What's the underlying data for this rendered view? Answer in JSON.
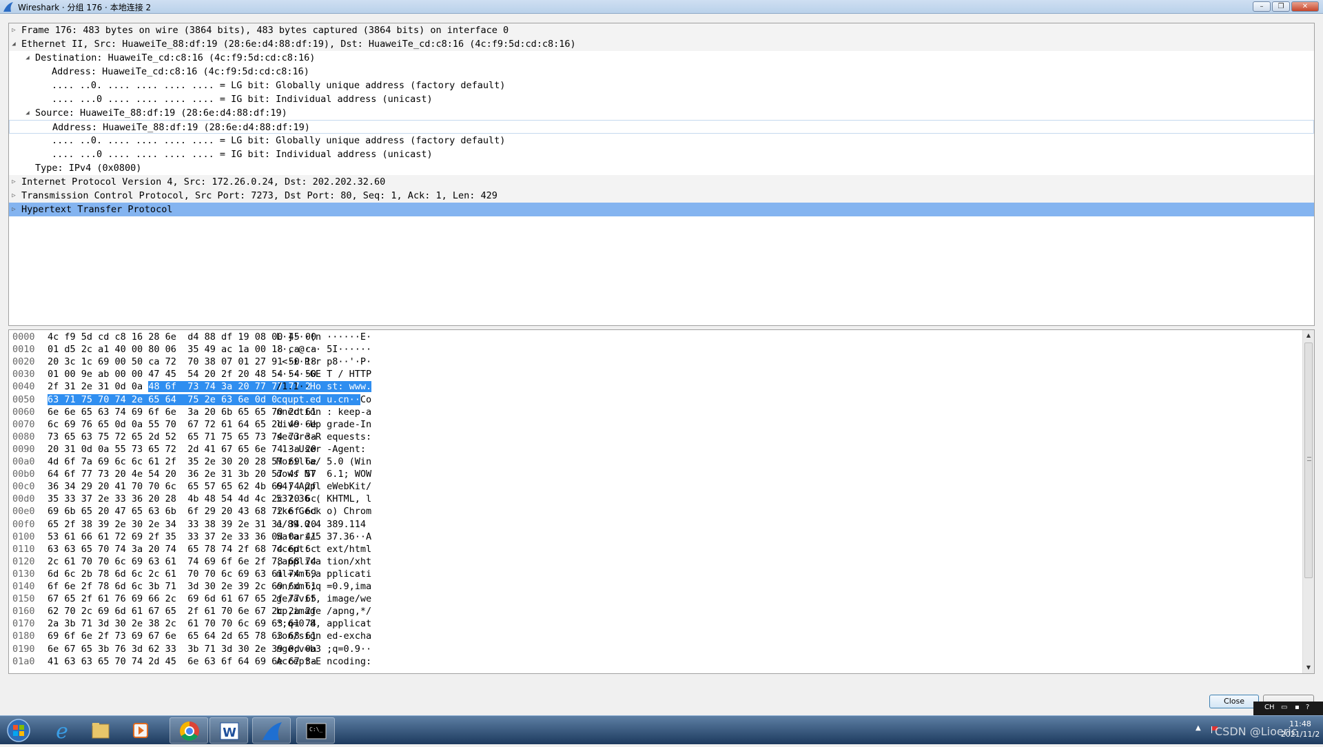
{
  "window": {
    "title": "Wireshark · 分组 176 · 本地连接 2",
    "controls": {
      "minimize": "–",
      "maximize": "❐",
      "close": "✕"
    }
  },
  "detail_tree": [
    {
      "expander": "collapsed",
      "text": "Frame 176: 483 bytes on wire (3864 bits), 483 bytes captured (3864 bits) on interface 0",
      "shaded": true
    },
    {
      "expander": "expanded",
      "text": "Ethernet II, Src: HuaweiTe_88:df:19 (28:6e:d4:88:df:19), Dst: HuaweiTe_cd:c8:16 (4c:f9:5d:cd:c8:16)",
      "shaded": true
    },
    {
      "expander": "expanded",
      "text": "Destination: HuaweiTe_cd:c8:16 (4c:f9:5d:cd:c8:16)"
    },
    {
      "expander": "none",
      "text": "Address: HuaweiTe_cd:c8:16 (4c:f9:5d:cd:c8:16)"
    },
    {
      "expander": "none",
      "text": ".... ..0. .... .... .... .... = LG bit: Globally unique address (factory default)"
    },
    {
      "expander": "none",
      "text": ".... ...0 .... .... .... .... = IG bit: Individual address (unicast)"
    },
    {
      "expander": "expanded",
      "text": "Source: HuaweiTe_88:df:19 (28:6e:d4:88:df:19)"
    },
    {
      "expander": "none",
      "text": "Address: HuaweiTe_88:df:19 (28:6e:d4:88:df:19)",
      "focused": true
    },
    {
      "expander": "none",
      "text": ".... ..0. .... .... .... .... = LG bit: Globally unique address (factory default)"
    },
    {
      "expander": "none",
      "text": ".... ...0 .... .... .... .... = IG bit: Individual address (unicast)"
    },
    {
      "expander": "none",
      "text": "Type: IPv4 (0x0800)"
    },
    {
      "expander": "collapsed",
      "text": "Internet Protocol Version 4, Src: 172.26.0.24, Dst: 202.202.32.60",
      "shaded": true
    },
    {
      "expander": "collapsed",
      "text": "Transmission Control Protocol, Src Port: 7273, Dst Port: 80, Seq: 1, Ack: 1, Len: 429",
      "shaded": true
    },
    {
      "expander": "collapsed",
      "text": "Hypertext Transfer Protocol",
      "selected": true
    }
  ],
  "hex_rows": [
    {
      "offset": "0000",
      "hex": "4c f9 5d cd c8 16 28 6e  d4 88 df 19 08 00 45 00",
      "ascii": "L·]···(n ······E·"
    },
    {
      "offset": "0010",
      "hex": "01 d5 2c a1 40 00 80 06  35 49 ac 1a 00 18 ca ca",
      "ascii": "··,·@··· 5I······"
    },
    {
      "offset": "0020",
      "hex": "20 3c 1c 69 00 50 ca 72  70 38 07 01 27 91 50 18",
      "ascii": " <·i·P·r p8··'·P·"
    },
    {
      "offset": "0030",
      "hex": "01 00 9e ab 00 00 47 45  54 20 2f 20 48 54 54 50",
      "ascii": "······GE T / HTTP"
    },
    {
      "offset": "0040",
      "hex": "2f 31 2e 31 0d 0a 48 6f  73 74 3a 20 77 77 77 2e",
      "ascii": "/1.1··Ho st: www.",
      "hl_from": 6
    },
    {
      "offset": "0050",
      "hex": "63 71 75 70 74 2e 65 64  75 2e 63 6e 0d 0a 43 6f",
      "ascii": "cqupt.ed u.cn··Co",
      "hl_to": 14
    },
    {
      "offset": "0060",
      "hex": "6e 6e 65 63 74 69 6f 6e  3a 20 6b 65 65 70 2d 61",
      "ascii": "nnection : keep-a"
    },
    {
      "offset": "0070",
      "hex": "6c 69 76 65 0d 0a 55 70  67 72 61 64 65 2d 49 6e",
      "ascii": "live··Up grade-In"
    },
    {
      "offset": "0080",
      "hex": "73 65 63 75 72 65 2d 52  65 71 75 65 73 74 73 3a",
      "ascii": "secure-R equests:"
    },
    {
      "offset": "0090",
      "hex": "20 31 0d 0a 55 73 65 72  2d 41 67 65 6e 74 3a 20",
      "ascii": " 1··User -Agent: "
    },
    {
      "offset": "00a0",
      "hex": "4d 6f 7a 69 6c 6c 61 2f  35 2e 30 20 28 57 69 6e",
      "ascii": "Mozilla/ 5.0 (Win"
    },
    {
      "offset": "00b0",
      "hex": "64 6f 77 73 20 4e 54 20  36 2e 31 3b 20 57 4f 57",
      "ascii": "dows NT  6.1; WOW"
    },
    {
      "offset": "00c0",
      "hex": "36 34 29 20 41 70 70 6c  65 57 65 62 4b 69 74 2f",
      "ascii": "64) Appl eWebKit/"
    },
    {
      "offset": "00d0",
      "hex": "35 33 37 2e 33 36 20 28  4b 48 54 4d 4c 2c 20 6c",
      "ascii": "537.36 ( KHTML, l"
    },
    {
      "offset": "00e0",
      "hex": "69 6b 65 20 47 65 63 6b  6f 29 20 43 68 72 6f 6d",
      "ascii": "ike Geck o) Chrom"
    },
    {
      "offset": "00f0",
      "hex": "65 2f 38 39 2e 30 2e 34  33 38 39 2e 31 31 34 20",
      "ascii": "e/89.0.4 389.114 "
    },
    {
      "offset": "0100",
      "hex": "53 61 66 61 72 69 2f 35  33 37 2e 33 36 0d 0a 41",
      "ascii": "Safari/5 37.36··A"
    },
    {
      "offset": "0110",
      "hex": "63 63 65 70 74 3a 20 74  65 78 74 2f 68 74 6d 6c",
      "ascii": "ccept: t ext/html"
    },
    {
      "offset": "0120",
      "hex": "2c 61 70 70 6c 69 63 61  74 69 6f 6e 2f 78 68 74",
      "ascii": ",applica tion/xht"
    },
    {
      "offset": "0130",
      "hex": "6d 6c 2b 78 6d 6c 2c 61  70 70 6c 69 63 61 74 69",
      "ascii": "ml+xml,a pplicati"
    },
    {
      "offset": "0140",
      "hex": "6f 6e 2f 78 6d 6c 3b 71  3d 30 2e 39 2c 69 6d 61",
      "ascii": "on/xml;q =0.9,ima"
    },
    {
      "offset": "0150",
      "hex": "67 65 2f 61 76 69 66 2c  69 6d 61 67 65 2f 77 65",
      "ascii": "ge/avif, image/we"
    },
    {
      "offset": "0160",
      "hex": "62 70 2c 69 6d 61 67 65  2f 61 70 6e 67 2c 2a 2f",
      "ascii": "bp,image /apng,*/"
    },
    {
      "offset": "0170",
      "hex": "2a 3b 71 3d 30 2e 38 2c  61 70 70 6c 69 63 61 74",
      "ascii": "*;q=0.8, applicat"
    },
    {
      "offset": "0180",
      "hex": "69 6f 6e 2f 73 69 67 6e  65 64 2d 65 78 63 68 61",
      "ascii": "ion/sign ed-excha"
    },
    {
      "offset": "0190",
      "hex": "6e 67 65 3b 76 3d 62 33  3b 71 3d 30 2e 39 0d 0a",
      "ascii": "nge;v=b3 ;q=0.9··"
    },
    {
      "offset": "01a0",
      "hex": "41 63 63 65 70 74 2d 45  6e 63 6f 64 69 6e 67 3a",
      "ascii": "Accept-E ncoding:"
    }
  ],
  "footer": {
    "close_label": "Close"
  },
  "taskbar": {
    "apps": [
      "start-orb-icon",
      "ie-icon",
      "explorer-icon",
      "media-player-icon",
      "chrome-icon",
      "word-icon",
      "wireshark-icon",
      "cmd-icon"
    ],
    "clock_time": "11:48",
    "clock_date": "2021/11/2",
    "watermark": "CSDN @Lioeric",
    "lang": "CH"
  },
  "colors": {
    "selection": "#84b4f0",
    "hex_highlight": "#2f8ef0",
    "accent": "#2f8ef0"
  }
}
